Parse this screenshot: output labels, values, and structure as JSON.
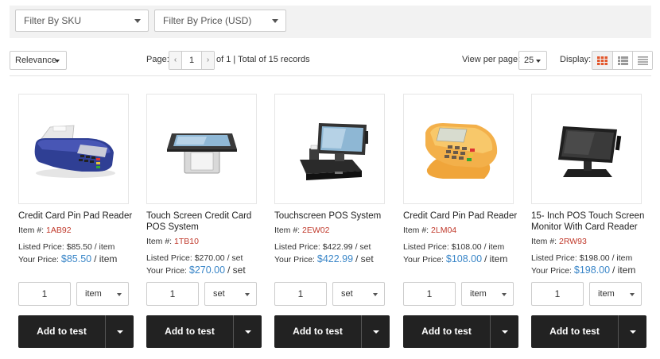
{
  "filters": {
    "sku": "Filter By SKU",
    "price": "Filter By Price (USD)"
  },
  "toolbar": {
    "sort": "Relevance",
    "page_label": "Page:",
    "page_prev": "‹",
    "page_value": "1",
    "page_next": "›",
    "page_total": "of 1 | Total of 15 records",
    "view_per_page_label": "View per page:",
    "view_per_page": "25",
    "display_label": "Display:",
    "display_modes": [
      "grid-view-icon",
      "list-view-icon",
      "compact-list-icon"
    ],
    "accent": "#e2562b"
  },
  "products": [
    {
      "name": "Credit Card Pin Pad Reader",
      "item_label": "Item #:",
      "item_code": "1AB92",
      "listed": "Listed Price: $85.50 / item",
      "your_label": "Your Price:",
      "your_price": "$85.50",
      "your_unit": "/ item",
      "qty": "1",
      "uom": "item",
      "add": "Add to test",
      "image": "card-reader-image"
    },
    {
      "name": "Touch Screen Credit Card POS System",
      "item_label": "Item #:",
      "item_code": "1TB10",
      "listed": "Listed Price: $270.00 / set",
      "your_label": "Your Price:",
      "your_price": "$270.00",
      "your_unit": "/ set",
      "qty": "1",
      "uom": "set",
      "add": "Add to test",
      "image": "pos-printer-terminal-image"
    },
    {
      "name": "Touchscreen POS System",
      "item_label": "Item #:",
      "item_code": "2EW02",
      "listed": "Listed Price: $422.99 / set",
      "your_label": "Your Price:",
      "your_price": "$422.99",
      "your_unit": "/ set",
      "qty": "1",
      "uom": "set",
      "add": "Add to test",
      "image": "pos-cash-drawer-image"
    },
    {
      "name": "Credit Card Pin Pad Reader",
      "item_label": "Item #:",
      "item_code": "2LM04",
      "listed": "Listed Price: $108.00 / item",
      "your_label": "Your Price:",
      "your_price": "$108.00",
      "your_unit": "/ item",
      "qty": "1",
      "uom": "item",
      "add": "Add to test",
      "image": "yellow-pin-pad-image"
    },
    {
      "name": "15- Inch POS Touch Screen Monitor With Card Reader",
      "item_label": "Item #:",
      "item_code": "2RW93",
      "listed": "Listed Price: $198.00 / item",
      "your_label": "Your Price:",
      "your_price": "$198.00",
      "your_unit": "/ item",
      "qty": "1",
      "uom": "item",
      "add": "Add to test",
      "image": "touch-monitor-image"
    }
  ]
}
